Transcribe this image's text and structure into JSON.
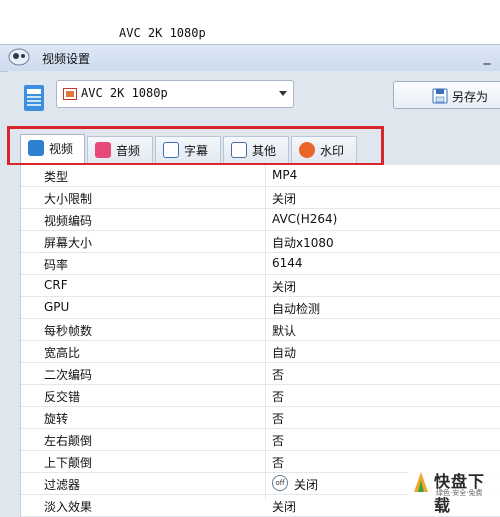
{
  "background": {
    "title": "AVC 2K 1080p"
  },
  "window": {
    "title": "视频设置",
    "minimize_glyph": "_"
  },
  "toolbar": {
    "preset": {
      "value": "AVC 2K 1080p"
    },
    "save_as_label": "另存为"
  },
  "tabs": [
    {
      "label": "视频",
      "icon": "video-icon",
      "color": "#2d7fd1",
      "active": true
    },
    {
      "label": "音频",
      "icon": "music-icon",
      "color": "#e8487a",
      "active": false
    },
    {
      "label": "字幕",
      "icon": "subtitle-icon",
      "color": "#3a6fb8",
      "active": false
    },
    {
      "label": "其他",
      "icon": "sliders-icon",
      "color": "#4b6d9a",
      "active": false
    },
    {
      "label": "水印",
      "icon": "watermark-icon",
      "color": "#e8642a",
      "active": false
    }
  ],
  "settings": [
    {
      "name": "类型",
      "value": "MP4"
    },
    {
      "name": "大小限制",
      "value": "关闭"
    },
    {
      "name": "视频编码",
      "value": "AVC(H264)"
    },
    {
      "name": "屏幕大小",
      "value": "自动x1080"
    },
    {
      "name": "码率",
      "value": "6144"
    },
    {
      "name": "CRF",
      "value": "关闭"
    },
    {
      "name": "GPU",
      "value": "自动检测"
    },
    {
      "name": "每秒帧数",
      "value": "默认"
    },
    {
      "name": "宽高比",
      "value": "自动"
    },
    {
      "name": "二次编码",
      "value": "否"
    },
    {
      "name": "反交错",
      "value": "否"
    },
    {
      "name": "旋转",
      "value": "否"
    },
    {
      "name": "左右颠倒",
      "value": "否"
    },
    {
      "name": "上下颠倒",
      "value": "否"
    },
    {
      "name": "过滤器",
      "value": "关闭",
      "toggle_text": "off"
    },
    {
      "name": "淡入效果",
      "value": "关闭"
    }
  ],
  "watermark": {
    "text": "快盘下载",
    "subtitle": "绿色·安全·免费"
  },
  "colors": {
    "highlight": "#d9262c",
    "titlebar": "#d3dff0"
  }
}
